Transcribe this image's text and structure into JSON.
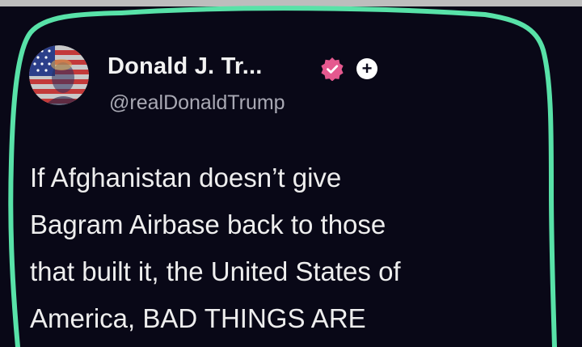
{
  "tweet": {
    "display_name": "Donald J. Tr...",
    "handle": "@realDonaldTrump",
    "verified_icon": "verified-badge-icon",
    "follow_icon": "plus-icon",
    "avatar_icon": "american-flag-portrait",
    "text_lines": [
      "If Afghanistan doesn’t give",
      "Bagram Airbase back to those",
      "that built it, the United States of",
      "America, BAD THINGS ARE"
    ]
  },
  "colors": {
    "background": "#090817",
    "highlight_outline": "#58e2a8",
    "verified_badge": "#e5598f",
    "name_text": "#f2f2f2",
    "handle_text": "#a9a9b4",
    "body_text": "#eeeeee"
  }
}
